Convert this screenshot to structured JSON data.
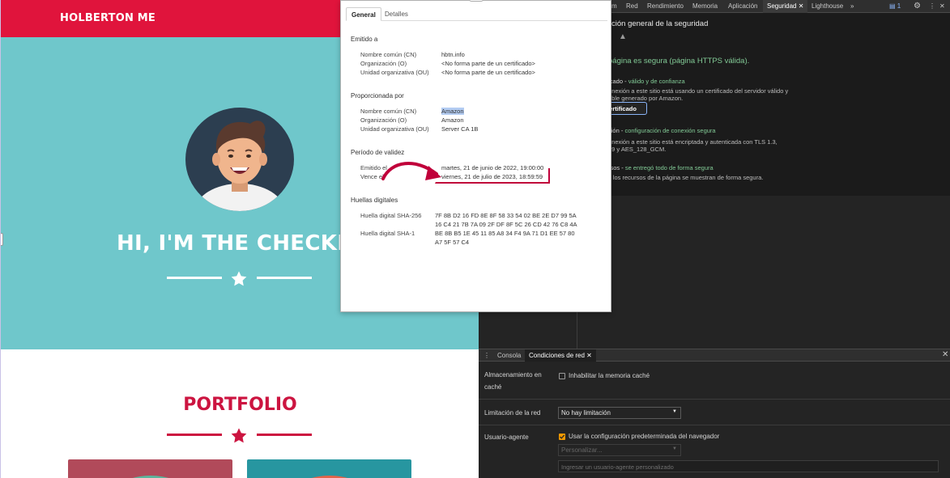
{
  "site": {
    "logo": "HOLBERTON ME",
    "hero_title": "HI, I'M THE CHECKE",
    "portfolio_title": "PORTFOLIO",
    "colors": {
      "nav": "#e0143c",
      "hero": "#6fc7cb",
      "accent": "#cc1440",
      "card_1": "#b14a5a",
      "card_2": "#2796a0"
    },
    "icons": [
      "star-icon"
    ]
  },
  "devtools": {
    "tabs": [
      "m",
      "Red",
      "Rendimiento",
      "Memoria",
      "Aplicación",
      "Seguridad",
      "Lighthouse",
      "»"
    ],
    "active_tab": "Seguridad",
    "badge_count": "1",
    "security": {
      "header": "ción general de la seguridad",
      "summary": "página es segura (página HTTPS válida).",
      "certificate_title": "ficado",
      "certificate_status": "válido y de confianza",
      "certificate_body_1": "onexión a este sitio está usando un certificado del servidor válido y",
      "certificate_body_2": "able generado por Amazon.",
      "view_certificate_button": "r certificado",
      "connection_title": "xión",
      "connection_status": "configuración de conexión segura",
      "connection_body_1": "onexión a este sitio está encriptada y autenticada con TLS 1.3,",
      "connection_body_2": "19 y AES_128_GCM.",
      "resources_title": "rsos",
      "resources_status": "se entregó todo de forma segura",
      "resources_body": "s los recursos de la página se muestran de forma segura."
    },
    "drawer": {
      "tabs": [
        "Consola",
        "Condiciones de red"
      ],
      "active_tab": "Condiciones de red",
      "cache_label_1": "Almacenamiento en",
      "cache_label_2": "caché",
      "cache_checkbox": "Inhabilitar la memoria caché",
      "cache_checked": false,
      "throttle_label": "Limitación de la red",
      "throttle_value": "No hay limitación",
      "ua_label": "Usuario-agente",
      "ua_checkbox": "Usar la configuración predeterminada del navegador",
      "ua_checked": true,
      "ua_select_placeholder": "Personalizar...",
      "ua_input_placeholder": "Ingresar un usuario-agente personalizado"
    }
  },
  "certificate": {
    "tabs": [
      "General",
      "Detalles"
    ],
    "active_tab": "General",
    "issued_to": {
      "heading": "Emitido a",
      "cn_label": "Nombre común (CN)",
      "cn": "hbtn.info",
      "o_label": "Organización (O)",
      "o": "<No forma parte de un certificado>",
      "ou_label": "Unidad organizativa (OU)",
      "ou": "<No forma parte de un certificado>"
    },
    "issued_by": {
      "heading": "Proporcionada por",
      "cn_label": "Nombre común (CN)",
      "cn": "Amazon",
      "o_label": "Organización (O)",
      "o": "Amazon",
      "ou_label": "Unidad organizativa (OU)",
      "ou": "Server CA 1B"
    },
    "validity": {
      "heading": "Período de validez",
      "issued_label": "Emitido el",
      "issued": "martes, 21 de junio de 2022, 19:00:00",
      "expires_label": "Vence el",
      "expires": "viernes, 21 de julio de 2023, 18:59:59"
    },
    "fingerprints": {
      "heading": "Huellas digitales",
      "sha256_label": "Huella digital SHA-256",
      "sha256_line1": "7F 8B D2 16 FD 8E 8F 58 33 54 02 BE 2E D7 99 5A",
      "sha256_line2": "16 C4 21 7B 7A 09 2F DF 8F 5C 26 CD 42 76 C8 4A",
      "sha1_label": "Huella digital SHA-1",
      "sha1_line1": "BE 8B B5 1E 45 11 85 A8 34 F4 9A 71 D1 EE 57 80",
      "sha1_line2": "A7 5F 57 C4"
    },
    "annotation_color": "#c0003a"
  }
}
